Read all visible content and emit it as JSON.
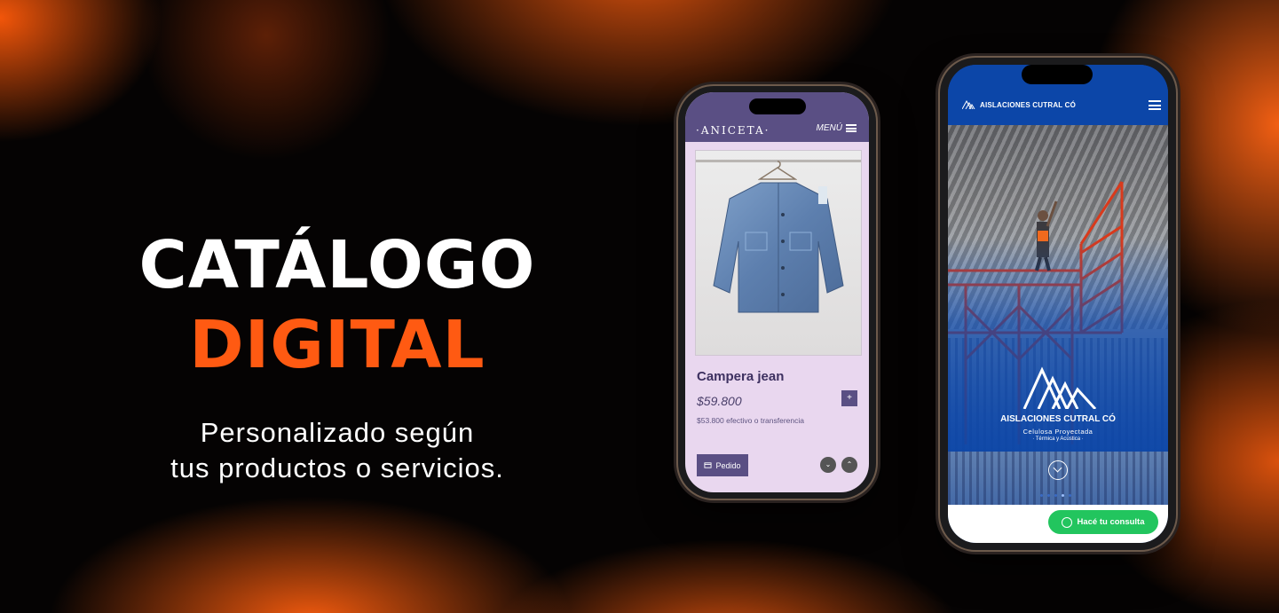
{
  "hero": {
    "line1": "CATÁLOGO",
    "line2": "DIGITAL",
    "sub1": "Personalizado según",
    "sub2": "tus productos o servicios."
  },
  "colors": {
    "accent": "#ff5a12",
    "aniceta": "#5a4f84",
    "cutral": "#0c46a8",
    "whatsapp": "#22c55e"
  },
  "phone1": {
    "brand": "·ANICETA·",
    "menu_label": "MENÚ",
    "product_title": "Campera jean",
    "price": "$59.800",
    "price_alt": "$53.800 efectivo o transferencia",
    "plus_label": "+",
    "order_label": "Pedido",
    "icons": [
      "menu-icon",
      "cart-icon",
      "chevron-down-icon",
      "chevron-up-icon"
    ]
  },
  "phone2": {
    "brand": "AISLACIONES CUTRAL CÓ",
    "company_name": "AISLACIONES CUTRAL CÓ",
    "tagline": "Celulosa Proyectada",
    "tagline2": "· Térmica y Acústica ·",
    "whatsapp_label": "Hacé tu consulta",
    "icons": [
      "logo-icon",
      "menu-icon",
      "chevron-down-icon",
      "whatsapp-icon"
    ]
  }
}
